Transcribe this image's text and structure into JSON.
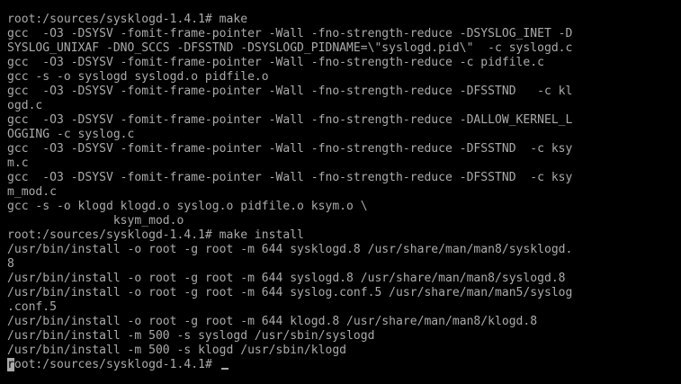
{
  "terminal": {
    "colors": {
      "background": "#000000",
      "foreground": "#aaaaaa"
    },
    "lines": [
      "root:/sources/sysklogd-1.4.1# make",
      "gcc  -O3 -DSYSV -fomit-frame-pointer -Wall -fno-strength-reduce -DSYSLOG_INET -D",
      "SYSLOG_UNIXAF -DNO_SCCS -DFSSTND -DSYSLOGD_PIDNAME=\\\"syslogd.pid\\\"  -c syslogd.c",
      "gcc  -O3 -DSYSV -fomit-frame-pointer -Wall -fno-strength-reduce -c pidfile.c",
      "gcc -s -o syslogd syslogd.o pidfile.o",
      "gcc  -O3 -DSYSV -fomit-frame-pointer -Wall -fno-strength-reduce -DFSSTND   -c kl",
      "ogd.c",
      "gcc  -O3 -DSYSV -fomit-frame-pointer -Wall -fno-strength-reduce -DALLOW_KERNEL_L",
      "OGGING -c syslog.c",
      "gcc  -O3 -DSYSV -fomit-frame-pointer -Wall -fno-strength-reduce -DFSSTND  -c ksy",
      "m.c",
      "gcc  -O3 -DSYSV -fomit-frame-pointer -Wall -fno-strength-reduce -DFSSTND  -c ksy",
      "m_mod.c",
      "gcc -s -o klogd klogd.o syslog.o pidfile.o ksym.o \\",
      "               ksym_mod.o",
      "root:/sources/sysklogd-1.4.1# make install",
      "/usr/bin/install -o root -g root -m 644 sysklogd.8 /usr/share/man/man8/sysklogd.",
      "8",
      "/usr/bin/install -o root -g root -m 644 syslogd.8 /usr/share/man/man8/syslogd.8",
      "/usr/bin/install -o root -g root -m 644 syslog.conf.5 /usr/share/man/man5/syslog",
      ".conf.5",
      "/usr/bin/install -o root -g root -m 644 klogd.8 /usr/share/man/man8/klogd.8",
      "/usr/bin/install -m 500 -s syslogd /usr/sbin/syslogd",
      "/usr/bin/install -m 500 -s klogd /usr/sbin/klogd"
    ],
    "prompt": {
      "first_char": "r",
      "rest": "oot:/sources/sysklogd-1.4.1# "
    }
  }
}
